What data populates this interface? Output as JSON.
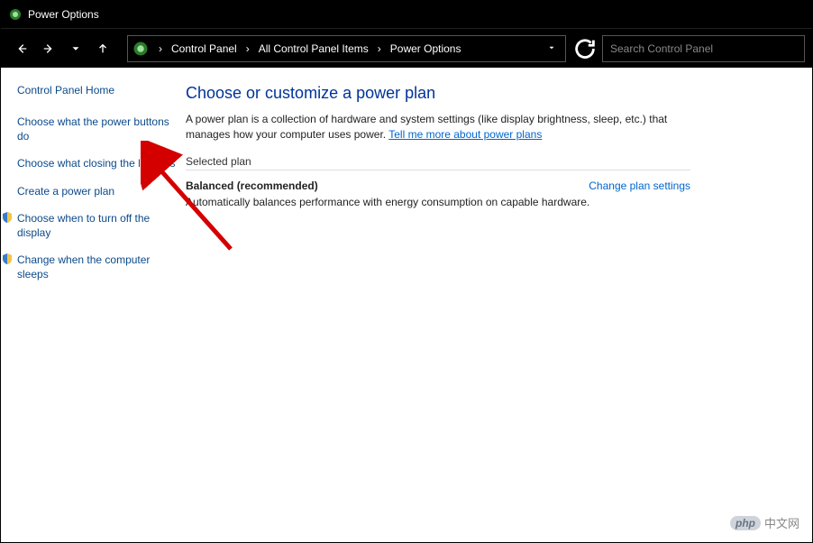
{
  "titlebar": {
    "title": "Power Options"
  },
  "breadcrumb": {
    "items": [
      "Control Panel",
      "All Control Panel Items",
      "Power Options"
    ]
  },
  "search": {
    "placeholder": "Search Control Panel"
  },
  "sidebar": {
    "home": "Control Panel Home",
    "items": [
      "Choose what the power buttons do",
      "Choose what closing the lid does",
      "Create a power plan",
      "Choose when to turn off the display",
      "Change when the computer sleeps"
    ]
  },
  "main": {
    "heading": "Choose or customize a power plan",
    "desc_prefix": "A power plan is a collection of hardware and system settings (like display brightness, sleep, etc.) that manages how your computer uses power. ",
    "desc_link": "Tell me more about power plans",
    "section_label": "Selected plan",
    "plan_name": "Balanced (recommended)",
    "plan_change": "Change plan settings",
    "plan_desc": "Automatically balances performance with energy consumption on capable hardware."
  },
  "watermark": {
    "brand": "php",
    "text": "中文网"
  }
}
